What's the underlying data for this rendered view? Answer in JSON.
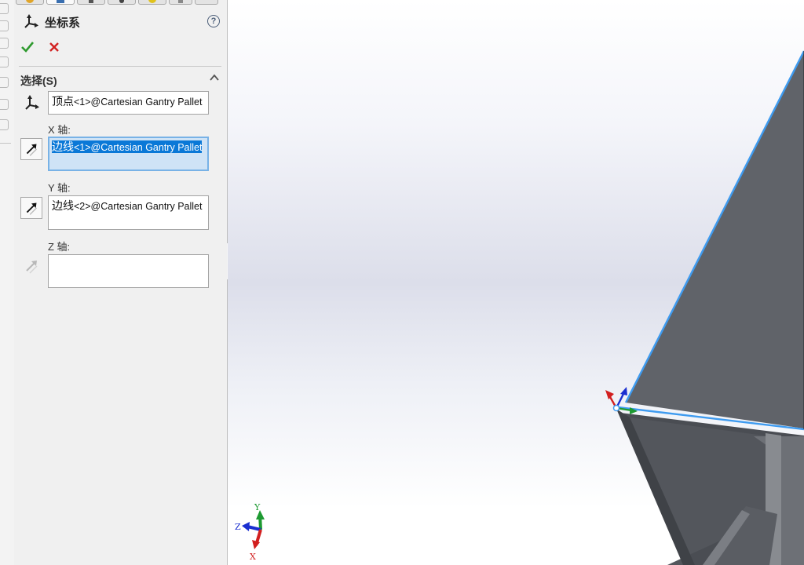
{
  "panel": {
    "title": "坐标系",
    "help_label": "?",
    "section": {
      "title": "选择(S)"
    },
    "origin": {
      "value_cn": "顶点",
      "value_ref": "<1>@Cartesian Gantry Pallet"
    },
    "x_axis": {
      "label": "X 轴:",
      "value_cn": "边线",
      "value_ref": "<1>@Cartesian Gantry Pallet"
    },
    "y_axis": {
      "label": "Y 轴:",
      "value_cn": "边线",
      "value_ref": "<2>@Cartesian Gantry Pallet"
    },
    "z_axis": {
      "label": "Z 轴:",
      "value": ""
    }
  },
  "viewport": {
    "view_triad": {
      "x_label": "X",
      "y_label": "Y",
      "z_label": "Z"
    }
  },
  "colors": {
    "ok_green": "#2e9a2e",
    "cancel_red": "#d22222",
    "selection_blue": "#0a78d7",
    "edge_highlight": "#3e9bf0",
    "model_face": "#62656b"
  }
}
